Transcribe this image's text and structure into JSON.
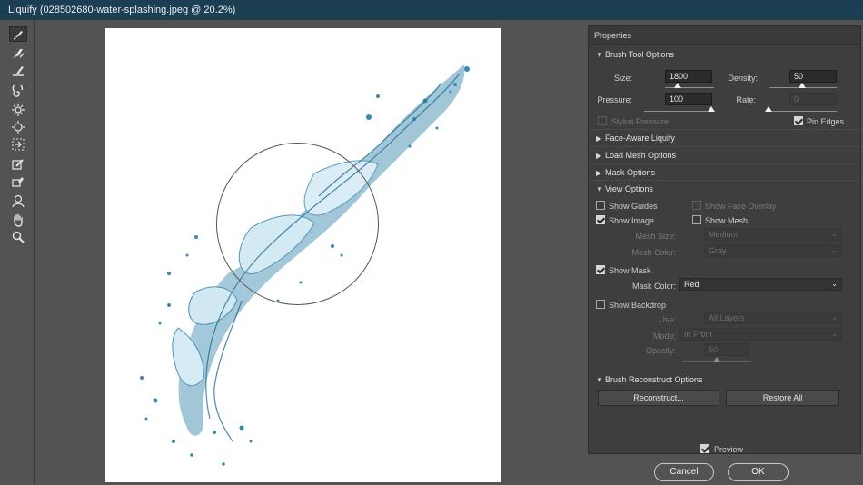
{
  "window": {
    "title": "Liquify (028502680-water-splashing.jpeg @ 20.2%)"
  },
  "tools": [
    {
      "name": "forward-warp-tool-icon",
      "active": true
    },
    {
      "name": "reconstruct-tool-icon"
    },
    {
      "name": "smooth-tool-icon"
    },
    {
      "name": "twirl-clockwise-tool-icon"
    },
    {
      "name": "pucker-tool-icon"
    },
    {
      "name": "bloat-tool-icon"
    },
    {
      "name": "push-left-tool-icon"
    },
    {
      "name": "freeze-mask-tool-icon"
    },
    {
      "name": "thaw-mask-tool-icon"
    },
    {
      "name": "face-tool-icon"
    },
    {
      "name": "hand-tool-icon"
    },
    {
      "name": "zoom-tool-icon"
    }
  ],
  "properties": {
    "header": "Properties",
    "brush_tool_options": {
      "title": "Brush Tool Options",
      "size_label": "Size:",
      "size_value": "1800",
      "size_fraction": 0.45,
      "density_label": "Density:",
      "density_value": "50",
      "density_fraction": 0.5,
      "pressure_label": "Pressure:",
      "pressure_value": "100",
      "pressure_fraction": 1.0,
      "rate_label": "Rate:",
      "rate_value": "0",
      "rate_fraction": 0.0,
      "stylus_pressure_label": "Stylus Pressure",
      "pin_edges_label": "Pin Edges"
    },
    "face_aware_label": "Face-Aware Liquify",
    "load_mesh_label": "Load Mesh Options",
    "mask_options_label": "Mask Options",
    "view_options": {
      "title": "View Options",
      "show_guides": "Show Guides",
      "show_face_overlay": "Show Face Overlay",
      "show_image": "Show Image",
      "show_mesh": "Show Mesh",
      "mesh_size_label": "Mesh Size:",
      "mesh_size_value": "Medium",
      "mesh_color_label": "Mesh Color:",
      "mesh_color_value": "Gray",
      "show_mask": "Show Mask",
      "mask_color_label": "Mask Color:",
      "mask_color_value": "Red",
      "show_backdrop": "Show Backdrop",
      "use_label": "Use:",
      "use_value": "All Layers",
      "mode_label": "Mode:",
      "mode_value": "In Front",
      "opacity_label": "Opacity:",
      "opacity_value": "50",
      "opacity_fraction": 0.5
    },
    "brush_reconstruct": {
      "title": "Brush Reconstruct Options",
      "reconstruct_label": "Reconstruct...",
      "restore_all_label": "Restore All"
    }
  },
  "footer": {
    "preview_label": "Preview",
    "cancel_label": "Cancel",
    "ok_label": "OK"
  }
}
